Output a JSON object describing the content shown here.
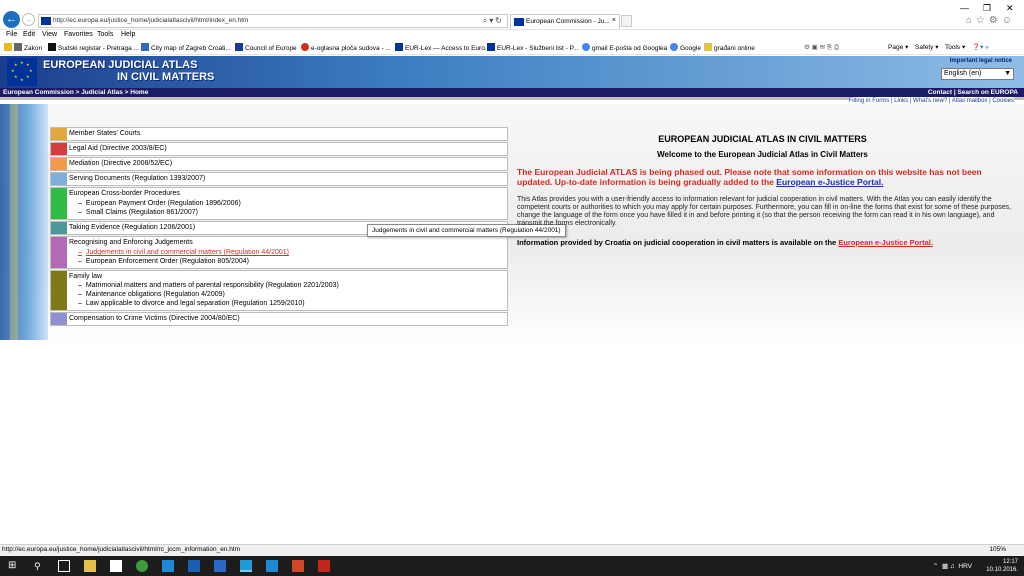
{
  "browser": {
    "url": "http://ec.europa.eu/justice_home/judicialatlascivil/html/index_en.htm",
    "tab_title": "European Commission - Ju...",
    "menu": [
      "File",
      "Edit",
      "View",
      "Favorites",
      "Tools",
      "Help"
    ],
    "favorites": [
      {
        "label": "Zakon",
        "icon": "z-icon"
      },
      {
        "label": "Sudski registar - Pretraga ...",
        "icon": "registry-icon"
      },
      {
        "label": "City map of Zagreb Croati...",
        "icon": "map-icon"
      },
      {
        "label": "Council of Europe",
        "icon": "coe-icon"
      },
      {
        "label": "e-oglasna ploča sudova - ...",
        "icon": "e-icon"
      },
      {
        "label": "EUR-Lex — Access to Euro...",
        "icon": "eurlex-icon"
      },
      {
        "label": "EUR-Lex - Službeni list - P...",
        "icon": "eurlex-icon"
      },
      {
        "label": "gmail E-pošta od Googlea",
        "icon": "google-icon"
      },
      {
        "label": "Google",
        "icon": "google-icon"
      },
      {
        "label": "građani online",
        "icon": "folder-icon"
      }
    ],
    "commands": [
      "Page ▾",
      "Safety ▾",
      "Tools ▾"
    ],
    "status_url": "http://ec.europa.eu/justice_home/judicialatlascivil/html/rc_jccm_information_en.htm",
    "zoom": "105%"
  },
  "header": {
    "title_line1": "EUROPEAN JUDICIAL ATLAS",
    "title_line2": "IN CIVIL MATTERS",
    "legal_notice": "Important legal notice",
    "language": "English (en)"
  },
  "nav": {
    "breadcrumb": "European Commission > Judicial Atlas  > Home",
    "top_links": "Contact | Search on EUROPA",
    "toolbar_links": "Filling in Forms  |  Links  |  What's new?  |  Atlas mailbox  |  Cookies"
  },
  "categories": [
    {
      "title": "Member States' Courts",
      "color": "#e3a83a",
      "subs": []
    },
    {
      "title": "Legal Aid (Directive 2003/8/EC)",
      "color": "#d43d3d",
      "subs": []
    },
    {
      "title": "Mediation (Directive 2008/52/EC)",
      "color": "#f39a4a",
      "subs": []
    },
    {
      "title": "Serving Documents (Regulation 1393/2007)",
      "color": "#7fb0d9",
      "subs": []
    },
    {
      "title": "European Cross-border Procedures",
      "color": "#2fbd46",
      "subs": [
        "European Payment Order (Regulation 1896/2006)",
        "Small Claims (Regulation 861/2007)"
      ]
    },
    {
      "title": "Taking Evidence (Regulation 1206/2001)",
      "color": "#4a9a9c",
      "subs": []
    },
    {
      "title": "Recognising and Enforcing Judgements",
      "color": "#b369b6",
      "subs": [
        "Judgements in civil and commercial matters (Regulation 44/2001)",
        "European Enforcement Order (Regulation 805/2004)"
      ]
    },
    {
      "title": "Family law",
      "color": "#7f7a17",
      "subs": [
        "Matrimonial matters and matters of parental responsibility (Regulation 2201/2003)",
        "Maintenance obligations (Regulation 4/2009)",
        "Law applicable to divorce and legal separation (Regulation 1259/2010)"
      ]
    },
    {
      "title": "Compensation to Crime Victims (Directive 2004/80/EC)",
      "color": "#8f8fd4",
      "subs": []
    }
  ],
  "tooltip": "Judgements in civil and commercial matters (Regulation 44/2001)",
  "main": {
    "heading": "EUROPEAN JUDICIAL ATLAS IN CIVIL MATTERS",
    "subheading": "Welcome to the European Judicial Atlas in Civil Matters",
    "phaseout_text": "The European Judicial ATLAS is being phased out. Please note that some information on this website has not been updated. Up-to-date information is being gradually added to the",
    "phaseout_link": "European e-Justice Portal.",
    "about_text": "This Atlas provides you with a user-friendly access to information relevant for judicial cooperation in civil matters. With the Atlas you can easily identify the competent courts or authorities to which you may apply for certain purposes. Furthermore, you can fill in on-line the forms that exist for some of these purposes, change the language of the form once you have filled it in and before printing it (so that the person receiving the form can read it in his own language), and transmit the forms electronically.",
    "croatia_text": "Information provided by Croatia on judicial cooperation in civil matters is available on the",
    "croatia_link": "European e-Justice Portal."
  },
  "taskbar": {
    "language": "HRV",
    "time": "12:17",
    "date": "10.10.2016."
  }
}
